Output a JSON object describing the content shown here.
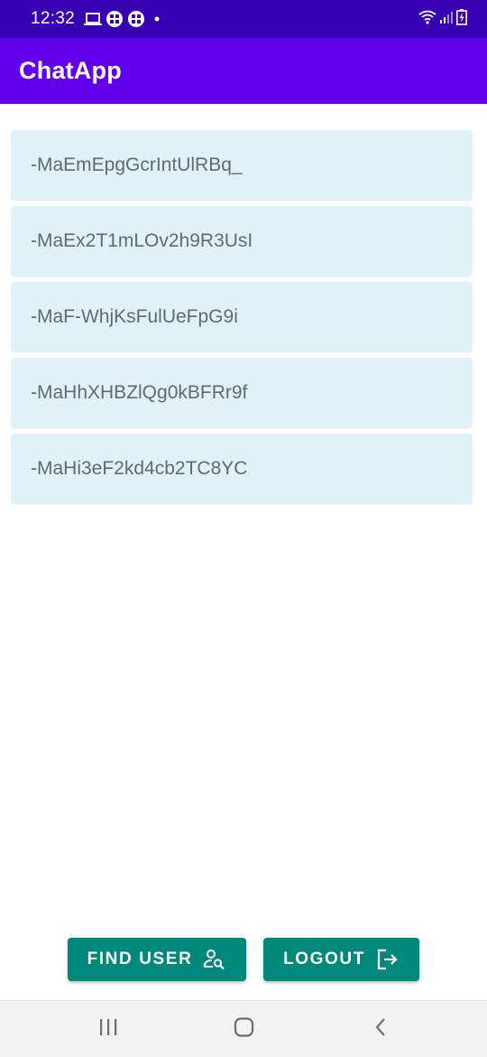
{
  "status_bar": {
    "time": "12:32",
    "left_icons": [
      "laptop-icon",
      "app-icon",
      "app-icon",
      "dot-icon"
    ],
    "right_icons": [
      "wifi-icon",
      "signal-icon",
      "battery-charging-icon"
    ]
  },
  "app_bar": {
    "title": "ChatApp"
  },
  "chat_list": {
    "items": [
      {
        "label": "-MaEmEpgGcrIntUlRBq_"
      },
      {
        "label": "-MaEx2T1mLOv2h9R3UsI"
      },
      {
        "label": "-MaF-WhjKsFulUeFpG9i"
      },
      {
        "label": "-MaHhXHBZlQg0kBFRr9f"
      },
      {
        "label": "-MaHi3eF2kd4cb2TC8YC"
      }
    ]
  },
  "actions": {
    "find_user_label": "FIND USER",
    "find_user_icon": "person-search-icon",
    "logout_label": "LOGOUT",
    "logout_icon": "logout-icon"
  },
  "nav_bar": {
    "buttons": [
      "recents-icon",
      "home-icon",
      "back-icon"
    ]
  },
  "colors": {
    "status_bar": "#3700B3",
    "app_bar": "#6200EE",
    "list_item_bg": "#E0F2F7",
    "button_bg": "#00897B"
  }
}
